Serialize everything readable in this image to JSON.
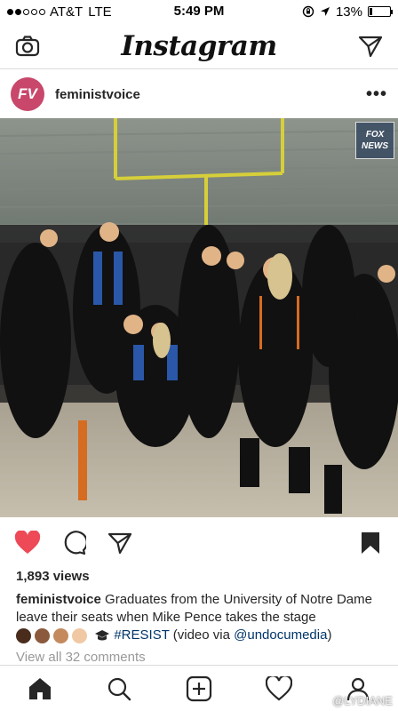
{
  "status": {
    "carrier": "AT&T",
    "network": "LTE",
    "time": "5:49 PM",
    "battery": "13%",
    "battery_level": 0.13,
    "signal_bars": 2
  },
  "nav": {
    "brand": "Instagram",
    "left_icon": "camera-icon",
    "right_icon": "direct-message-icon"
  },
  "post": {
    "avatar_initials": "FV",
    "username": "feministvoice",
    "more": "•••",
    "watermark_line1": "FOX",
    "watermark_line2": "NEWS",
    "views": "1,893 views",
    "caption_user": "feministvoice",
    "caption_text": "Graduates from the University of Notre Dame leave their seats when Mike Pence takes the stage",
    "hashtag": "#RESIST",
    "caption_via_prefix": "(video via",
    "mention": "@undocumedia",
    "caption_via_suffix": ")",
    "view_comments": "View all 32 comments"
  },
  "emoji_colors": [
    "#4a2c1d",
    "#8b5a3c",
    "#c48a5e",
    "#f0c9a4"
  ],
  "colors": {
    "like": "#ed4956",
    "avatar": "#c8476b",
    "link": "#003569"
  },
  "watermark_bottom": "@LYDIANE"
}
